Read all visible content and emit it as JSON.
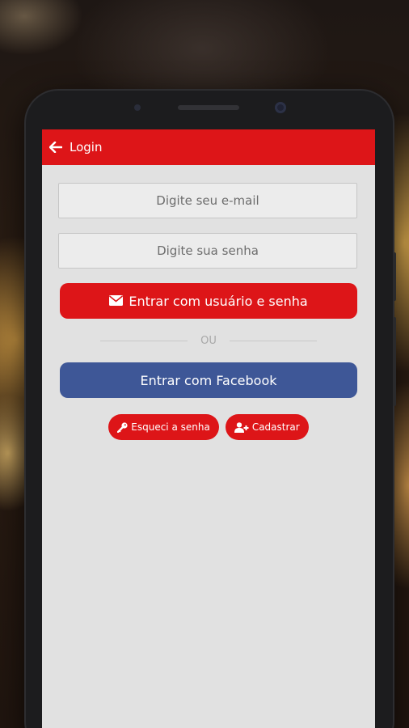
{
  "appbar": {
    "title": "Login"
  },
  "login_form": {
    "email_placeholder": "Digite seu e-mail",
    "password_placeholder": "Digite sua senha",
    "login_button_label": "Entrar com usuário e senha",
    "divider_text": "OU",
    "facebook_button_label": "Entrar com Facebook"
  },
  "links": {
    "forgot_password_label": "Esqueci a senha",
    "register_label": "Cadastrar"
  },
  "icons": {
    "back": "arrow-left-icon",
    "envelope": "envelope-icon",
    "key": "key-icon",
    "add_user": "user-plus-icon"
  },
  "colors": {
    "primary_red": "#dd1518",
    "facebook_blue": "#3e5797",
    "screen_background": "#e1e1e1"
  }
}
